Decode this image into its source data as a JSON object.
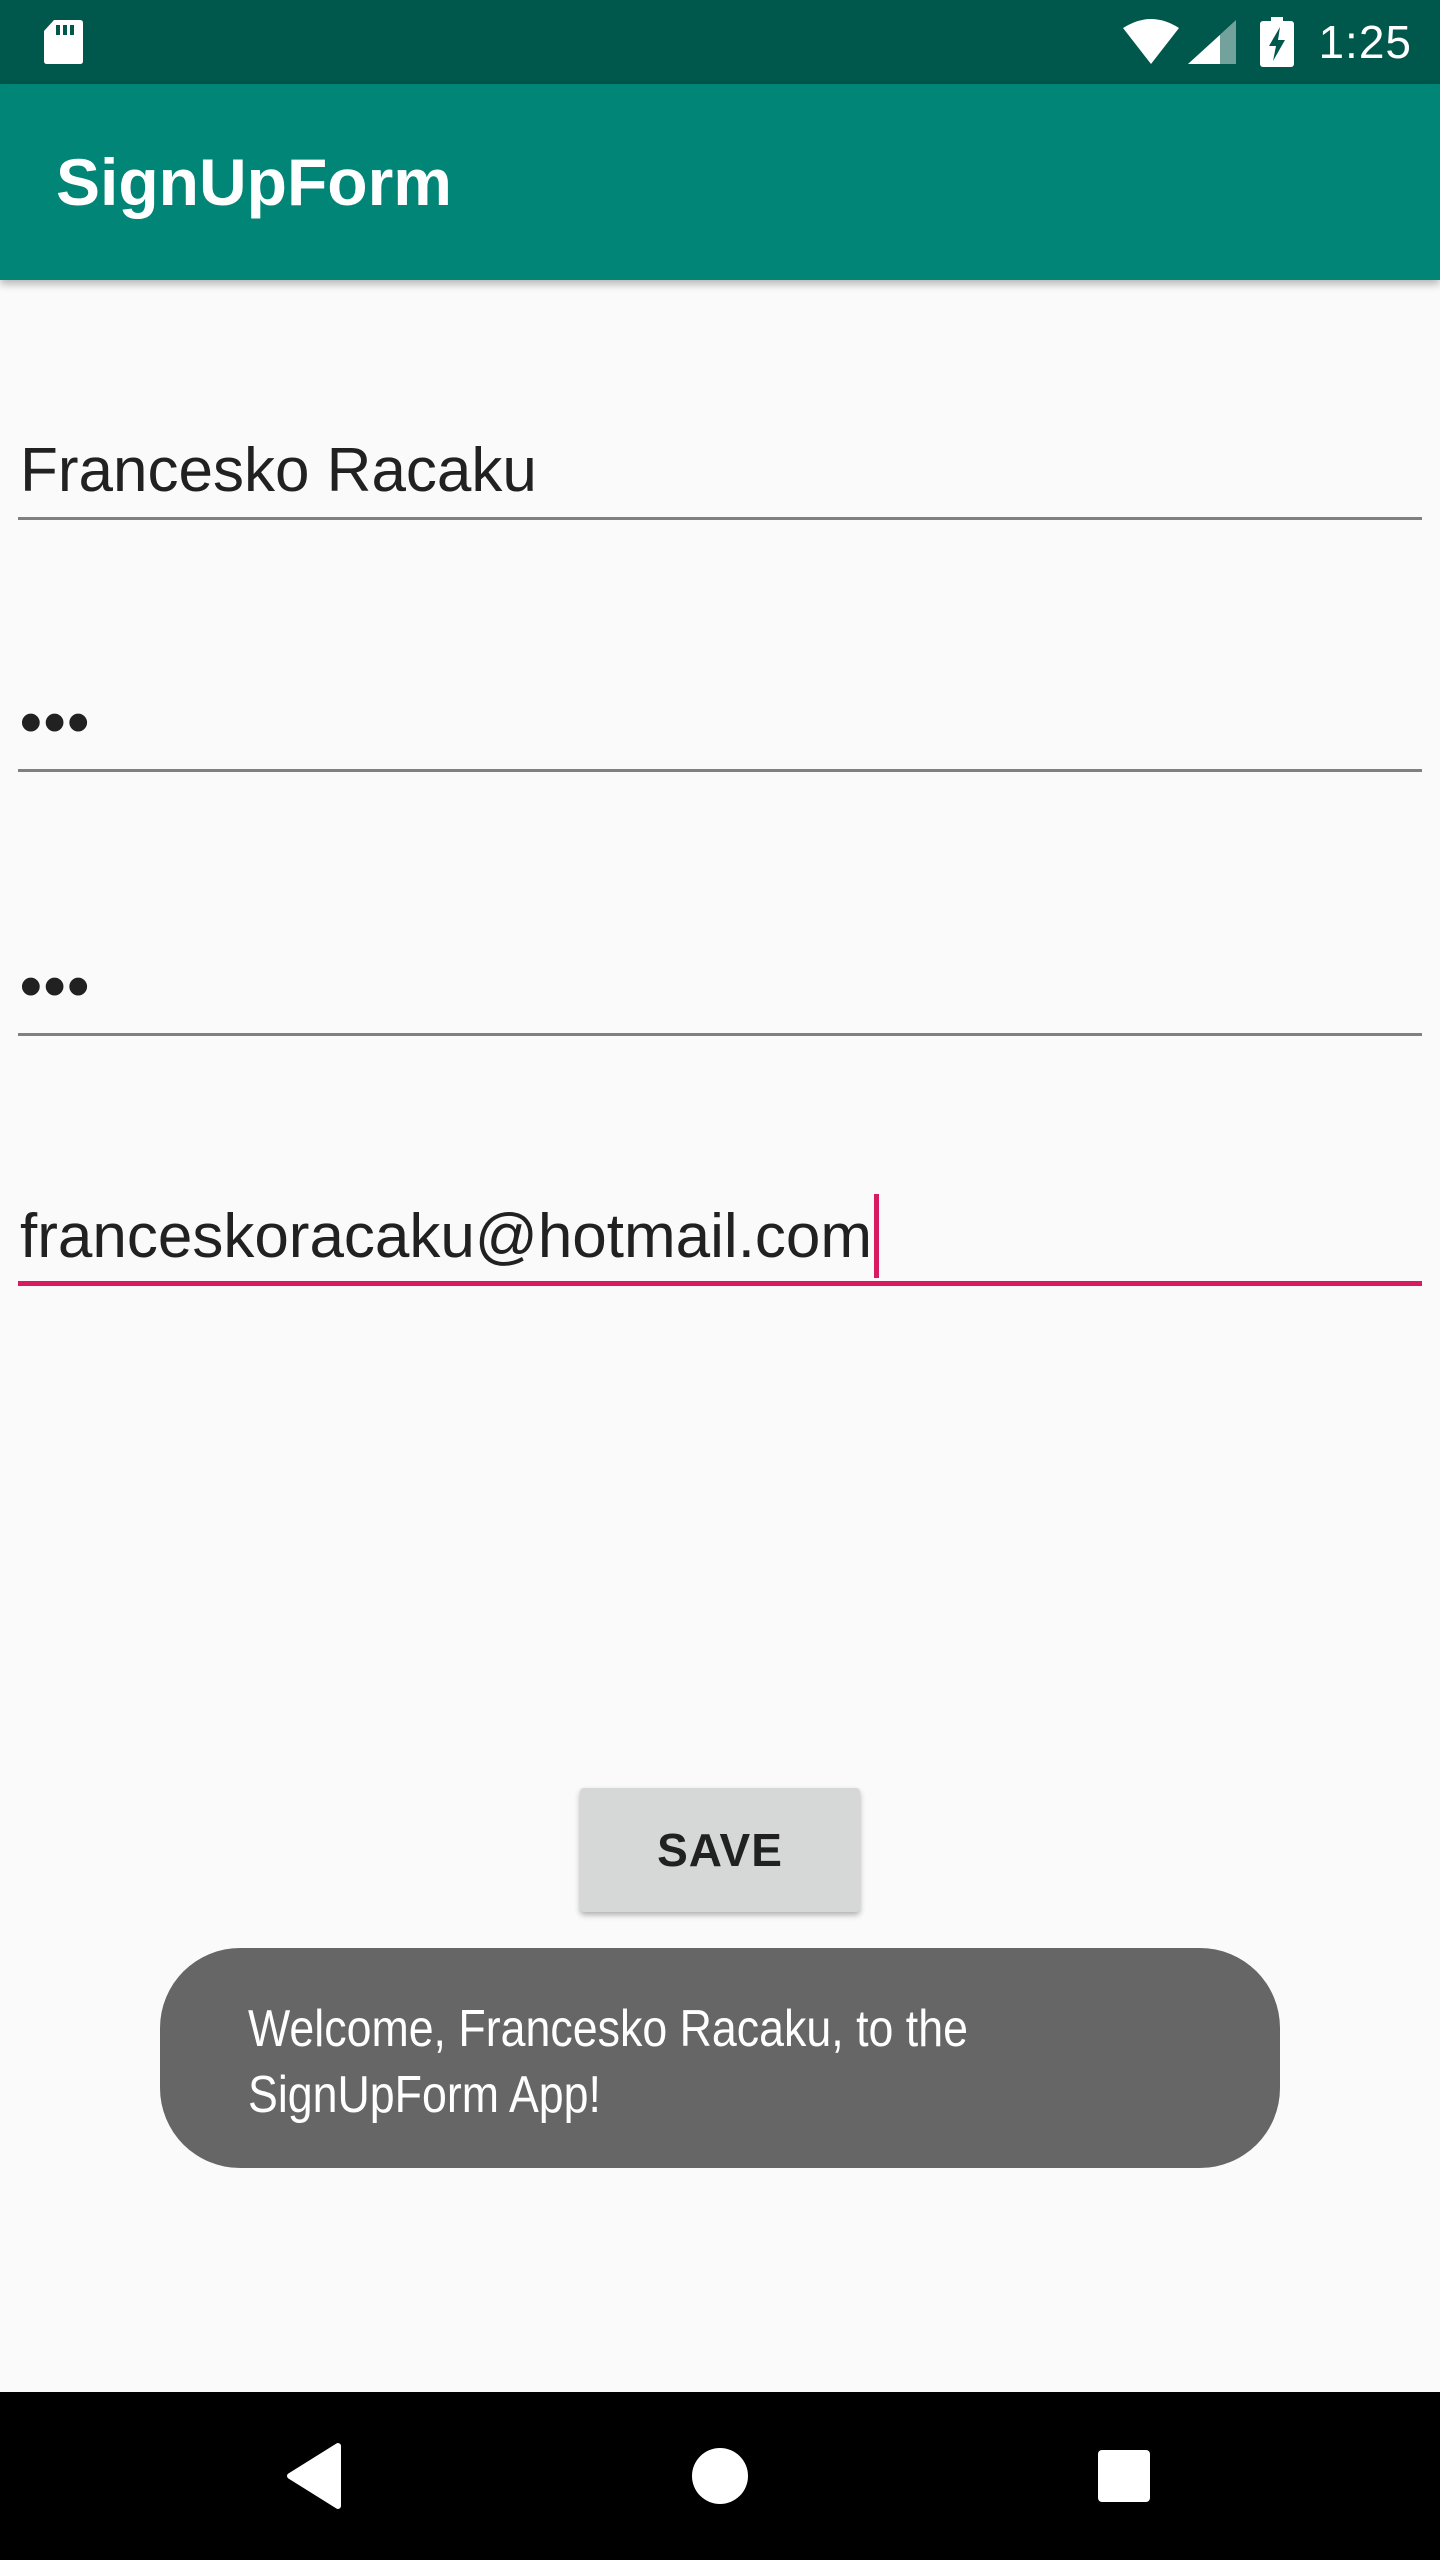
{
  "status_bar": {
    "time": "1:25",
    "icons": [
      "sd-card-icon",
      "wifi-icon",
      "signal-icon",
      "battery-charging-icon"
    ]
  },
  "app_bar": {
    "title": "SignUpForm"
  },
  "form": {
    "name_value": "Francesko Racaku",
    "password_mask": "•••",
    "confirm_password_mask": "•••",
    "email_value": "franceskoracaku@hotmail.com"
  },
  "save_button": {
    "label": "SAVE"
  },
  "toast": {
    "line1": "Welcome, Francesko Racaku, to the",
    "line2": "SignUpForm App!"
  },
  "nav_bar": {
    "icons": [
      "back-icon",
      "home-icon",
      "recents-icon"
    ]
  },
  "colors": {
    "status_bar": "#00574b",
    "app_bar": "#008577",
    "accent": "#d81b60",
    "background": "#fafafa",
    "toast": "#666666"
  }
}
